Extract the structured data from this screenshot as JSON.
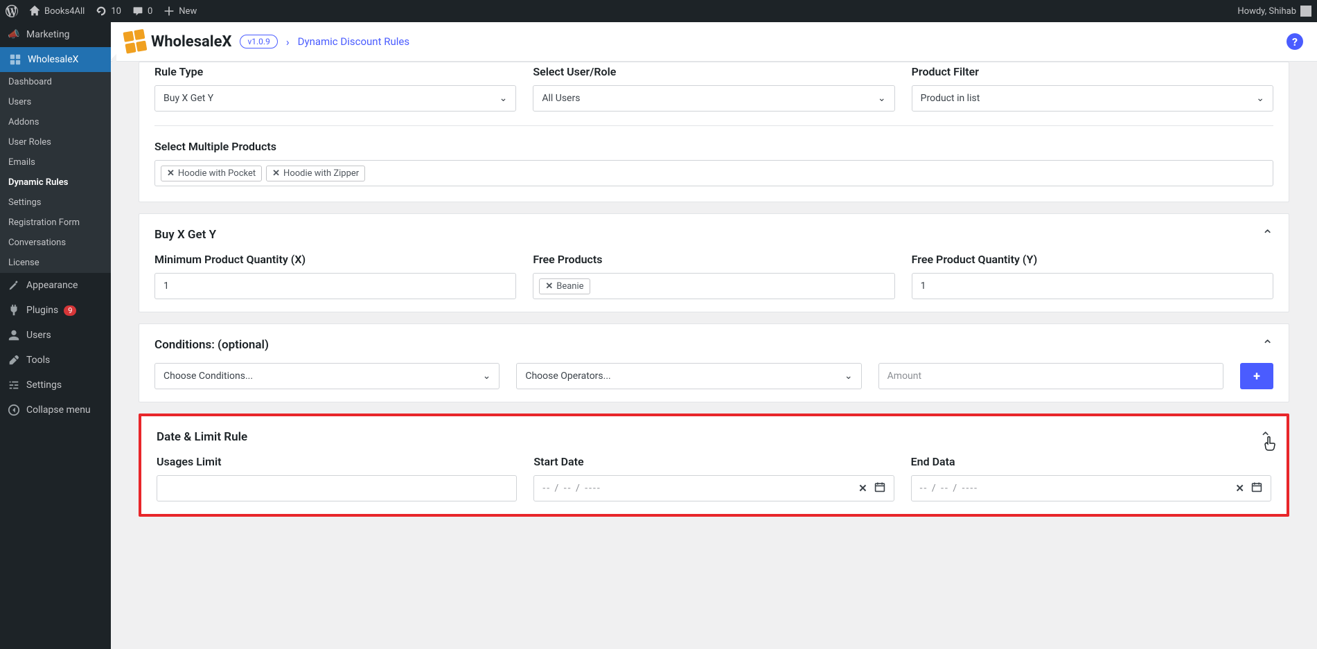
{
  "adminBar": {
    "siteName": "Books4All",
    "updates": "10",
    "comments": "0",
    "new": "New",
    "greeting": "Howdy, Shihab"
  },
  "sidebar": {
    "marketing": "Marketing",
    "wholesalex": "WholesaleX",
    "sub": {
      "dashboard": "Dashboard",
      "users": "Users",
      "addons": "Addons",
      "userRoles": "User Roles",
      "emails": "Emails",
      "dynamicRules": "Dynamic Rules",
      "settings": "Settings",
      "registrationForm": "Registration Form",
      "conversations": "Conversations",
      "license": "License"
    },
    "appearance": "Appearance",
    "plugins": "Plugins",
    "pluginsCount": "9",
    "usersMain": "Users",
    "tools": "Tools",
    "settingsMain": "Settings",
    "collapse": "Collapse menu"
  },
  "header": {
    "brand": "WholesaleX",
    "version": "v1.0.9",
    "breadcrumb": "Dynamic Discount Rules"
  },
  "panel1": {
    "ruleTypeLabel": "Rule Type",
    "ruleTypeValue": "Buy X Get Y",
    "selectUserLabel": "Select User/Role",
    "selectUserValue": "All Users",
    "productFilterLabel": "Product Filter",
    "productFilterValue": "Product in list",
    "selectProductsLabel": "Select Multiple Products",
    "product1": "Hoodie with Pocket",
    "product2": "Hoodie with Zipper"
  },
  "panel2": {
    "title": "Buy X Get Y",
    "minQtyLabel": "Minimum Product Quantity (X)",
    "minQtyValue": "1",
    "freeProductsLabel": "Free Products",
    "freeProduct1": "Beanie",
    "freeQtyLabel": "Free Product Quantity (Y)",
    "freeQtyValue": "1"
  },
  "panel3": {
    "title": "Conditions: (optional)",
    "conditionsPlaceholder": "Choose Conditions...",
    "operatorsPlaceholder": "Choose Operators...",
    "amountPlaceholder": "Amount"
  },
  "panel4": {
    "title": "Date & Limit Rule",
    "usagesLabel": "Usages Limit",
    "startDateLabel": "Start Date",
    "endDateLabel": "End Data",
    "datePlaceholder": "-- / -- / ----"
  }
}
